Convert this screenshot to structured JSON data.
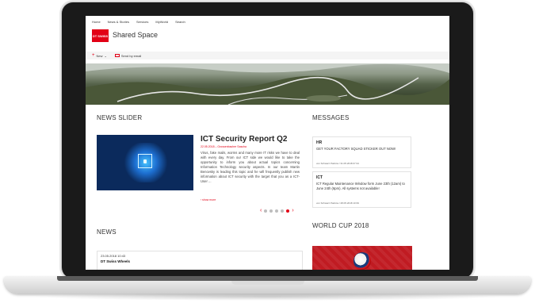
{
  "colors": {
    "brand": "#e20015",
    "text": "#333333",
    "border": "#e2e2e2",
    "frame": "#1a1a1a"
  },
  "topnav": {
    "items": [
      "Home",
      "News & Stories",
      "Services",
      "MyWorld",
      "Search"
    ]
  },
  "site": {
    "logo_text": "DT SWISS",
    "title": "Shared Space"
  },
  "commandbar": {
    "new_label": "New",
    "email_label": "Send by email"
  },
  "news_slider": {
    "heading": "NEWS SLIDER",
    "title": "ICT Security Report Q2",
    "meta": "22.05.2018 – Grossenbacher Sascha",
    "body": "Virus, fake mails, worms and many more IT risks we have to deal with every day. From our ICT side we would like to take the opportunity to inform you about actual topics concerning Information Technology security aspects. In our team Martin Benovsky is leading this topic and he will frequently publish new information about ICT security with the target that you as a ICT-User ...",
    "read_more": "show more",
    "pager": {
      "prev": "‹",
      "next": "›",
      "total_dots": 5,
      "active_dot": 5
    }
  },
  "messages": {
    "heading": "MESSAGES",
    "items": [
      {
        "title": "HR",
        "body": "GET YOUR FACTORY SQUAD STICKER OUT NOW!",
        "meta": "von Schwarz Patricia / 31.05.2018 07:34"
      },
      {
        "title": "ICT",
        "body": "ICT Regular Maintenance Window form June 23th (12am) to June 24th (6pm). All systems not available!",
        "meta": "von Schwarz Patricia / 28.05.2018 10:39"
      }
    ]
  },
  "news": {
    "heading": "NEWS",
    "date": "23.05.2018 10:43",
    "title": "DT Swiss Wheels"
  },
  "world_cup": {
    "heading": "WORLD CUP 2018"
  },
  "icons": {
    "new": "plus-icon",
    "email": "envelope-icon",
    "prev": "chevron-left-icon",
    "next": "chevron-right-icon",
    "lock": "lock-icon"
  }
}
